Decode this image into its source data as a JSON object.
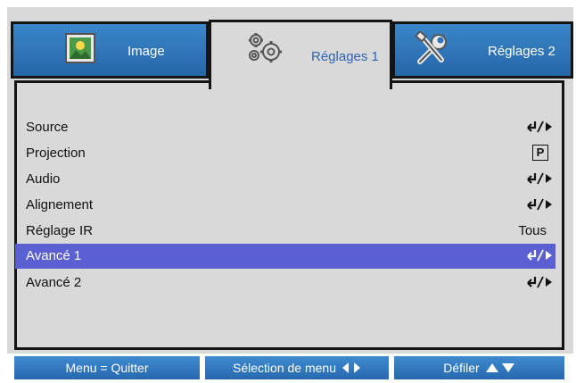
{
  "tabs": [
    {
      "label": "Image",
      "icon": "image-icon"
    },
    {
      "label": "Réglages 1",
      "icon": "gears-icon"
    },
    {
      "label": "Réglages 2",
      "icon": "tools-icon"
    }
  ],
  "menu": {
    "items": [
      {
        "label": "Source",
        "value_icon": "enter-arrow-icon"
      },
      {
        "label": "Projection",
        "value_text": "P"
      },
      {
        "label": "Audio",
        "value_icon": "enter-arrow-icon"
      },
      {
        "label": "Alignement",
        "value_icon": "enter-arrow-icon"
      },
      {
        "label": "Réglage IR",
        "value_text": "Tous"
      },
      {
        "label": "Avancé 1",
        "value_icon": "enter-arrow-icon"
      },
      {
        "label": "Avancé 2",
        "value_icon": "enter-arrow-icon"
      }
    ],
    "selected_index": 5
  },
  "footer": {
    "menu_quit": "Menu = Quitter",
    "menu_select": "Sélection de menu",
    "scroll": "Défiler"
  },
  "colors": {
    "tab_blue": "#2f73b8",
    "panel_gray": "#d9d9d9",
    "selected_row": "#5a60d2",
    "active_tab_text": "#2f64b7"
  }
}
